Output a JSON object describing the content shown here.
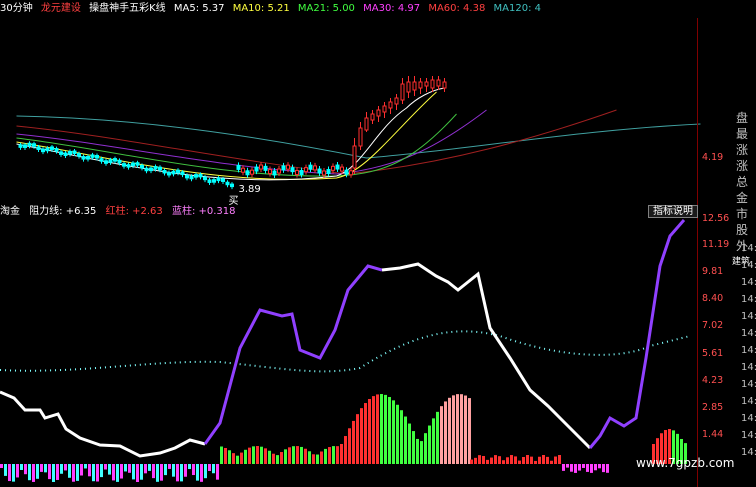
{
  "header": {
    "period": "30分钟",
    "stock_name": "龙元建设",
    "indicator": "操盘神手五彩K线",
    "ma5": "MA5: 5.37",
    "ma10": "MA10: 5.21",
    "ma21": "MA21: 5.00",
    "ma30": "MA30: 4.97",
    "ma60": "MA60: 4.38",
    "ma120": "MA120: 4"
  },
  "main_chart": {
    "price_ticks": [
      "4.19"
    ],
    "low_label": "3.89",
    "buy_label": "买"
  },
  "indicator_bar": {
    "name": "淘金",
    "resist": "阻力线: +6.35",
    "red": "红柱: +2.63",
    "blue": "蓝柱: +0.318",
    "help_button": "指标说明"
  },
  "indicator_axis": {
    "ticks": [
      "12.56",
      "11.19",
      "9.81",
      "8.40",
      "7.02",
      "5.61",
      "4.23",
      "2.85",
      "1.44"
    ]
  },
  "right_strip": {
    "chars": [
      "盘",
      "最",
      "涨",
      "涨",
      "总",
      "金",
      "市",
      "股",
      "外"
    ],
    "label": "建筑",
    "times": [
      "14:",
      "14:",
      "14:",
      "14:",
      "14:",
      "14:",
      "14:",
      "14:",
      "14:",
      "14:",
      "14:",
      "14:",
      "14:"
    ]
  },
  "watermark": "www.7gpzb.com",
  "colors": {
    "up": "#ff3030",
    "down": "#00ffff",
    "line_white": "#ffffff",
    "line_purple": "#9040ff",
    "dots": "#80ffff"
  }
}
